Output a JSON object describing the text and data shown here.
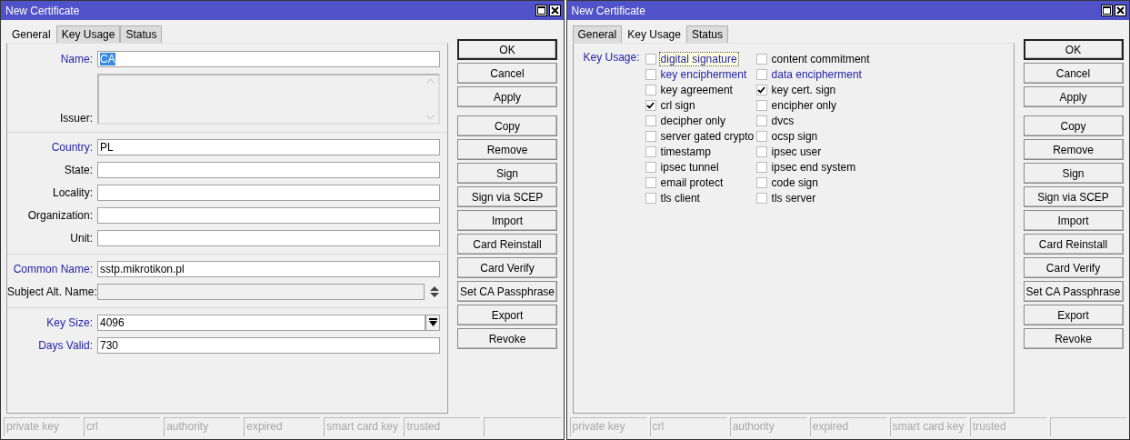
{
  "windows": [
    {
      "title": "New Certificate",
      "tabs": [
        {
          "label": "General",
          "selected": true
        },
        {
          "label": "Key Usage",
          "selected": false
        },
        {
          "label": "Status",
          "selected": false
        }
      ],
      "content": {
        "kind": "form",
        "groups": [
          {
            "fields": [
              {
                "kind": "text",
                "label": "Name:",
                "value": "CA",
                "highlighted": true,
                "disabled": false,
                "value_selected": true
              },
              {
                "kind": "textarea",
                "label": "Issuer:",
                "highlighted": false,
                "disabled": true
              }
            ]
          },
          {
            "fields": [
              {
                "kind": "text",
                "label": "Country:",
                "value": "PL",
                "highlighted": true,
                "disabled": false,
                "value_selected": false
              },
              {
                "kind": "text",
                "label": "State:",
                "highlighted": false,
                "disabled": false
              },
              {
                "kind": "text",
                "label": "Locality:",
                "highlighted": false,
                "disabled": false
              },
              {
                "kind": "text",
                "label": "Organization:",
                "highlighted": false,
                "disabled": false
              },
              {
                "kind": "text",
                "label": "Unit:",
                "highlighted": false,
                "disabled": false
              }
            ]
          },
          {
            "fields": [
              {
                "kind": "text",
                "label": "Common Name:",
                "value": "sstp.mikrotikon.pl",
                "highlighted": true,
                "disabled": false,
                "value_selected": false
              },
              {
                "kind": "list",
                "label": "Subject Alt. Name:",
                "highlighted": false,
                "disabled": true
              }
            ]
          },
          {
            "fields": [
              {
                "kind": "combo",
                "label": "Key Size:",
                "value": "4096",
                "highlighted": true,
                "disabled": false,
                "value_selected": false
              },
              {
                "kind": "text",
                "label": "Days Valid:",
                "value": "730",
                "highlighted": true,
                "disabled": false,
                "value_selected": false
              }
            ]
          }
        ]
      },
      "button_groups": [
        [
          {
            "label": "OK",
            "default": true
          },
          {
            "label": "Cancel",
            "default": false
          },
          {
            "label": "Apply",
            "default": false
          }
        ],
        [
          {
            "label": "Copy",
            "default": false
          },
          {
            "label": "Remove",
            "default": false
          },
          {
            "label": "Sign",
            "default": false
          },
          {
            "label": "Sign via SCEP",
            "default": false
          },
          {
            "label": "Import",
            "default": false
          },
          {
            "label": "Card Reinstall",
            "default": false
          },
          {
            "label": "Card Verify",
            "default": false
          },
          {
            "label": "Set CA Passphrase",
            "default": false
          },
          {
            "label": "Export",
            "default": false
          },
          {
            "label": "Revoke",
            "default": false
          }
        ]
      ],
      "status_bar": [
        "private key",
        "crl",
        "authority",
        "expired",
        "smart card key",
        "trusted"
      ]
    },
    {
      "title": "New Certificate",
      "tabs": [
        {
          "label": "General",
          "selected": false
        },
        {
          "label": "Key Usage",
          "selected": true
        },
        {
          "label": "Status",
          "selected": false
        }
      ],
      "content": {
        "kind": "checklist",
        "label": "Key Usage:",
        "highlighted": true,
        "columns": [
          [
            {
              "label": "digital signature",
              "checked": false,
              "highlighted": true,
              "focused": true
            },
            {
              "label": "key encipherment",
              "checked": false,
              "highlighted": true,
              "focused": false
            },
            {
              "label": "key agreement",
              "checked": false,
              "highlighted": false,
              "focused": false
            },
            {
              "label": "crl sign",
              "checked": true,
              "highlighted": false,
              "focused": false
            },
            {
              "label": "decipher only",
              "checked": false,
              "highlighted": false,
              "focused": false
            },
            {
              "label": "server gated crypto",
              "checked": false,
              "highlighted": false,
              "focused": false
            },
            {
              "label": "timestamp",
              "checked": false,
              "highlighted": false,
              "focused": false
            },
            {
              "label": "ipsec tunnel",
              "checked": false,
              "highlighted": false,
              "focused": false
            },
            {
              "label": "email protect",
              "checked": false,
              "highlighted": false,
              "focused": false
            },
            {
              "label": "tls client",
              "checked": false,
              "highlighted": false,
              "focused": false
            }
          ],
          [
            {
              "label": "content commitment",
              "checked": false,
              "highlighted": false,
              "focused": false
            },
            {
              "label": "data encipherment",
              "checked": false,
              "highlighted": true,
              "focused": false
            },
            {
              "label": "key cert. sign",
              "checked": true,
              "highlighted": false,
              "focused": false
            },
            {
              "label": "encipher only",
              "checked": false,
              "highlighted": false,
              "focused": false
            },
            {
              "label": "dvcs",
              "checked": false,
              "highlighted": false,
              "focused": false
            },
            {
              "label": "ocsp sign",
              "checked": false,
              "highlighted": false,
              "focused": false
            },
            {
              "label": "ipsec user",
              "checked": false,
              "highlighted": false,
              "focused": false
            },
            {
              "label": "ipsec end system",
              "checked": false,
              "highlighted": false,
              "focused": false
            },
            {
              "label": "code sign",
              "checked": false,
              "highlighted": false,
              "focused": false
            },
            {
              "label": "tls server",
              "checked": false,
              "highlighted": false,
              "focused": false
            }
          ]
        ]
      },
      "button_groups": [
        [
          {
            "label": "OK",
            "default": true
          },
          {
            "label": "Cancel",
            "default": false
          },
          {
            "label": "Apply",
            "default": false
          }
        ],
        [
          {
            "label": "Copy",
            "default": false
          },
          {
            "label": "Remove",
            "default": false
          },
          {
            "label": "Sign",
            "default": false
          },
          {
            "label": "Sign via SCEP",
            "default": false
          },
          {
            "label": "Import",
            "default": false
          },
          {
            "label": "Card Reinstall",
            "default": false
          },
          {
            "label": "Card Verify",
            "default": false
          },
          {
            "label": "Set CA Passphrase",
            "default": false
          },
          {
            "label": "Export",
            "default": false
          },
          {
            "label": "Revoke",
            "default": false
          }
        ]
      ],
      "status_bar": [
        "private key",
        "crl",
        "authority",
        "expired",
        "smart card key",
        "trusted"
      ]
    }
  ]
}
